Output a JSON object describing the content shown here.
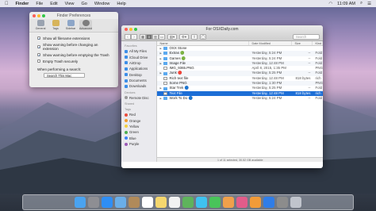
{
  "menubar": {
    "apple_icon": "apple-icon",
    "app_name": "Finder",
    "menus": [
      "File",
      "Edit",
      "View",
      "Go",
      "Window",
      "Help"
    ],
    "clock": "11:09 AM"
  },
  "prefs": {
    "title": "Finder Preferences",
    "tabs": [
      "General",
      "Tags",
      "Sidebar",
      "Advanced"
    ],
    "options": [
      {
        "label": "Show all filename extensions",
        "checked": true
      },
      {
        "label": "Show warning before changing an extension",
        "checked": true
      },
      {
        "label": "Show warning before emptying the Trash",
        "checked": true
      },
      {
        "label": "Empty Trash securely",
        "checked": false
      }
    ],
    "search_label": "When performing a search:",
    "search_value": "Search This Mac"
  },
  "finder": {
    "title": "For OSXDaily.com",
    "search_placeholder": "Search",
    "sidebar": {
      "favorites_head": "Favorites",
      "favorites": [
        "All My Files",
        "iCloud Drive",
        "AirDrop",
        "Applications",
        "Desktop",
        "Documents",
        "Downloads"
      ],
      "devices_head": "Devices",
      "devices": [
        "Remote Disc"
      ],
      "shared_head": "Shared",
      "tags_head": "Tags",
      "tags": [
        {
          "name": "Red",
          "color": "#e94b3c"
        },
        {
          "name": "Orange",
          "color": "#f39c2b"
        },
        {
          "name": "Yellow",
          "color": "#f4d03f"
        },
        {
          "name": "Green",
          "color": "#4caf50"
        },
        {
          "name": "Blue",
          "color": "#3b82f6"
        },
        {
          "name": "Purple",
          "color": "#9b59b6"
        }
      ]
    },
    "columns": {
      "name": "Name",
      "date": "Date Modified",
      "size": "Size",
      "kind": "Kind"
    },
    "rows": [
      {
        "name": "OSX Stone",
        "date": "",
        "size": "",
        "kind": "",
        "icon": "folder"
      },
      {
        "name": "Extras 🟢",
        "date": "Yesterday, 5:24 PM",
        "size": "--",
        "kind": "Fold",
        "icon": "folder"
      },
      {
        "name": "Games 🟢",
        "date": "Yesterday, 5:24 PM",
        "size": "--",
        "kind": "Fold",
        "icon": "folder"
      },
      {
        "name": "Image File",
        "date": "Yesterday, 12:48 PM",
        "size": "--",
        "kind": "Fold",
        "icon": "folder"
      },
      {
        "name": "IMG_9365.PNG",
        "date": "April 8, 2015, 1:35 PM",
        "size": "",
        "kind": "PNG",
        "icon": "doc"
      },
      {
        "name": "Junk 🔴",
        "date": "Yesterday, 5:25 PM",
        "size": "--",
        "kind": "Fold",
        "icon": "folder"
      },
      {
        "name": "Rich text file",
        "date": "Yesterday, 12:48 PM",
        "size": "818 bytes",
        "kind": "rich",
        "icon": "doc"
      },
      {
        "name": "Some PNG",
        "date": "Yesterday, 1:30 PM",
        "size": "",
        "kind": "PNG",
        "icon": "doc"
      },
      {
        "name": "Star Trek 🔵",
        "date": "Yesterday, 5:25 PM",
        "size": "--",
        "kind": "Fold",
        "icon": "folder"
      },
      {
        "name": "Text File",
        "date": "Yesterday, 12:48 PM",
        "size": "818 bytes",
        "kind": "rich",
        "icon": "doc",
        "selected": true
      },
      {
        "name": "Work To Do 🔵",
        "date": "Yesterday, 5:24 PM",
        "size": "--",
        "kind": "Fold",
        "icon": "folder"
      }
    ],
    "status": "1 of 11 selected, 30.52 GB available"
  },
  "dock_apps": [
    "finder",
    "launchpad",
    "safari",
    "mail",
    "contacts",
    "calendar",
    "notes",
    "reminders",
    "maps",
    "messages",
    "facetime",
    "photos",
    "itunes",
    "ibooks",
    "app-store",
    "preferences",
    "trash"
  ]
}
